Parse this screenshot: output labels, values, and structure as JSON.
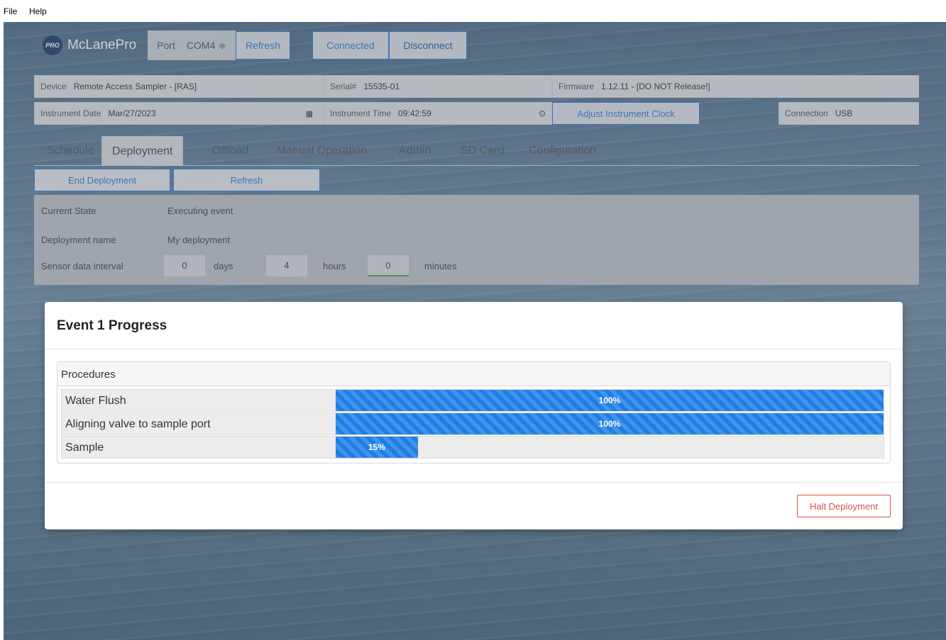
{
  "menu": {
    "file": "File",
    "help": "Help"
  },
  "header": {
    "logo_badge": "PRO",
    "app_name": "McLanePro",
    "port_label": "Port",
    "port_value": "COM4 ≑",
    "refresh": "Refresh",
    "connected": "Connected",
    "disconnect": "Disconnect"
  },
  "device_info": {
    "device_label": "Device",
    "device_value": "Remote Access Sampler - [RAS]",
    "serial_label": "Serial#",
    "serial_value": "15535-01",
    "firmware_label": "Firmware",
    "firmware_value": "1.12.11 - [DO NOT Release!]",
    "date_label": "Instrument Date",
    "date_value": "Mar/27/2023",
    "time_label": "Instrument Time",
    "time_value": "09:42:59",
    "adjust_clock": "Adjust Instrument Clock",
    "connection_label": "Connection",
    "connection_value": "USB"
  },
  "tabs": [
    "Schedule",
    "Deployment",
    "Offload",
    "Manual Operation",
    "Admin",
    "SD Card",
    "Configuration"
  ],
  "active_tab": "Deployment",
  "actions": {
    "end_deployment": "End Deployment",
    "refresh": "Refresh"
  },
  "deployment": {
    "state_label": "Current State",
    "state_value": "Executing event",
    "name_label": "Deployment name",
    "name_value": "My deployment",
    "interval_label": "Sensor data interval",
    "days": "0",
    "days_unit": "days",
    "hours": "4",
    "hours_unit": "hours",
    "minutes": "0",
    "minutes_unit": "minutes"
  },
  "modal": {
    "title": "Event 1 Progress",
    "table_header": "Procedures",
    "procedures": [
      {
        "name": "Water Flush",
        "percent": 100,
        "label": "100%"
      },
      {
        "name": "Aligning valve to sample port",
        "percent": 100,
        "label": "100%"
      },
      {
        "name": "Sample",
        "percent": 15,
        "label": "15%"
      }
    ],
    "halt": "Halt Deployment"
  },
  "colors": {
    "accent": "#1e7ee6",
    "danger": "#d9534f",
    "logo": "#1d3a6b"
  }
}
